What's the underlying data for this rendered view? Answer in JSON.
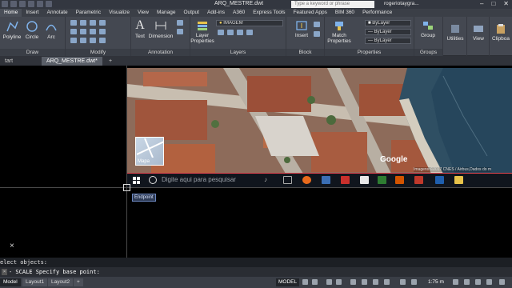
{
  "title_bar": {
    "document": "ARQ_MESTRE.dwt",
    "search_placeholder": "Type a keyword or phrase",
    "user": "rogeriotaygra..."
  },
  "ribbon_tabs": [
    "Home",
    "Insert",
    "Annotate",
    "Parametric",
    "Visualize",
    "View",
    "Manage",
    "Output",
    "Add-ins",
    "A360",
    "Express Tools",
    "Featured Apps",
    "BIM 360",
    "Performance"
  ],
  "ribbon": {
    "draw": {
      "title": "Draw",
      "tools": [
        "Polyline",
        "Circle",
        "Arc"
      ]
    },
    "modify": {
      "title": "Modify"
    },
    "annotation": {
      "title": "Annotation",
      "tools": [
        "Text",
        "Dimension"
      ]
    },
    "layers": {
      "title": "Layers",
      "layer_properties": "Layer Properties",
      "current_layer": "IMAGEM"
    },
    "block": {
      "title": "Block",
      "insert": "Insert"
    },
    "properties": {
      "title": "Properties",
      "match": "Match Properties",
      "bylayer": "ByLayer"
    },
    "groups": {
      "title": "Groups",
      "group": "Group"
    },
    "utilities": "Utilities",
    "view": "View",
    "clipboard": "Clipboa"
  },
  "file_tabs": {
    "start": "tart",
    "active": "ARQ_MESTRE.dwt*"
  },
  "map": {
    "thumbnail_label": "Mapa",
    "logo": "Google",
    "attribution": "Imagens ©2017 CNES / Airbus,Dados do m"
  },
  "taskbar": {
    "search_text": "Digite aqui para pesquisar"
  },
  "tooltip": "Endpoint",
  "ucs_mark": "×",
  "command": {
    "history": "elect objects:",
    "prompt": "- SCALE Specify base point:",
    "cmd_btn": "×"
  },
  "status_bar": {
    "layout_tabs": [
      "Model",
      "Layout1",
      "Layout2"
    ],
    "model_button": "MODEL",
    "scale": "1:75 m"
  }
}
